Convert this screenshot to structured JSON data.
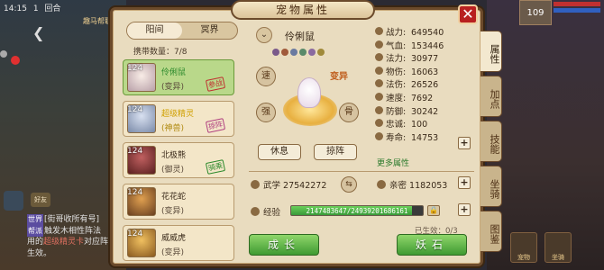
{
  "hud": {
    "time": "14:15",
    "indicator_a": "1",
    "indicator_b": "回合",
    "title": "趣马帮职",
    "player_level": "109",
    "chat_icon_label": "好友",
    "chat_lines": [
      {
        "tag": "世界",
        "text": "[街哥收所有号]"
      },
      {
        "tag": "帮派",
        "text": "触发木相性阵法"
      },
      {
        "text": "用的",
        "highlight": "超级精灵卡",
        "text2": "对应阵"
      },
      {
        "text": "生效。"
      }
    ],
    "bottom_icons": [
      "宠物",
      "坐骑"
    ]
  },
  "dialog": {
    "title": "宠物属性",
    "close_label": "✕",
    "side_tabs": [
      {
        "label": "属性",
        "active": true
      },
      {
        "label": "加点",
        "active": false
      },
      {
        "label": "技能",
        "active": false
      },
      {
        "label": "坐骑",
        "active": false
      },
      {
        "label": "图鉴",
        "active": false
      }
    ]
  },
  "left_panel": {
    "tabs": [
      {
        "label": "阳间",
        "active": true
      },
      {
        "label": "冥界",
        "active": false
      }
    ],
    "carry_label": "携带数量：",
    "carry_value": "7/8",
    "pets": [
      {
        "level": "124",
        "name": "伶俐鼠",
        "type": "(变异)",
        "name_color": "green",
        "stamp": "参战",
        "stamp_color": "red",
        "selected": true
      },
      {
        "level": "124",
        "name": "超级精灵",
        "type": "(神兽)",
        "name_color": "gold",
        "stamp": "掠阵",
        "stamp_color": "pink",
        "selected": false
      },
      {
        "level": "124",
        "name": "北极熊",
        "type": "(御灵)",
        "name_color": "default",
        "stamp": "骑乘",
        "stamp_color": "green",
        "selected": false
      },
      {
        "level": "124",
        "name": "花花蛇",
        "type": "(变异)",
        "name_color": "default",
        "stamp": "",
        "stamp_color": "",
        "selected": false
      },
      {
        "level": "124",
        "name": "威威虎",
        "type": "(变异)",
        "name_color": "default",
        "stamp": "",
        "stamp_color": "",
        "selected": false
      }
    ]
  },
  "pet_view": {
    "name": "伶俐鼠",
    "expand_icon": "chevron-down-icon",
    "skill_colors": [
      "#7a5a8a",
      "#a05a3a",
      "#6a7aa0",
      "#5a8a6a",
      "#8a6aa0",
      "#a08a3a"
    ],
    "stage_top_left": "速",
    "stage_top_right": "变异",
    "stage_mid_left": "强",
    "stage_mid_right": "骨",
    "rest_label": "休息",
    "sort_label": "掠阵"
  },
  "stats": [
    {
      "label": "战力:",
      "value": "649540"
    },
    {
      "label": "气血:",
      "value": "153446"
    },
    {
      "label": "法力:",
      "value": "30977"
    },
    {
      "label": "物伤:",
      "value": "16063"
    },
    {
      "label": "法伤:",
      "value": "26526"
    },
    {
      "label": "速度:",
      "value": "7692"
    },
    {
      "label": "防御:",
      "value": "30242"
    },
    {
      "label": "忠诚:",
      "value": "100"
    },
    {
      "label": "寿命:",
      "value": "14753"
    }
  ],
  "more_attr_label": "更多属性",
  "martial": {
    "label": "武学",
    "value": "27542272"
  },
  "intimacy": {
    "label": "亲密",
    "value": "1182053"
  },
  "experience": {
    "label": "经验",
    "text": "2147483647/24939201686161",
    "fill_fraction": 0.92
  },
  "effect_text": "已生效：0/3",
  "buttons": {
    "grow": "成长",
    "stone": "妖石"
  },
  "colors": {
    "accent_green": "#3f9a32",
    "frame": "#6b4a2b",
    "parchment": "#e9dcbf",
    "close_red": "#b82020"
  }
}
